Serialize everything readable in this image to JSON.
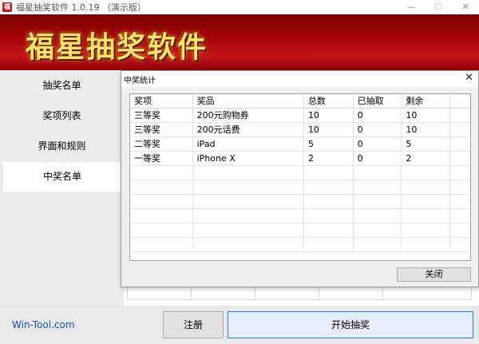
{
  "window": {
    "icon_glyph": "福",
    "title": "福星抽奖软件 1.0.19 （演示版）",
    "minimize_glyph": "—",
    "maximize_glyph": "☐",
    "close_glyph": "✕"
  },
  "banner": {
    "title": "福星抽奖软件"
  },
  "sidebar": {
    "items": [
      {
        "label": "抽奖名单"
      },
      {
        "label": "奖项列表"
      },
      {
        "label": "界面和规则"
      },
      {
        "label": "中奖名单"
      }
    ],
    "active_index": 3
  },
  "footer": {
    "brand": "Win-Tool.com",
    "register_label": "注册",
    "start_label": "开始抽奖"
  },
  "dialog": {
    "title": "中奖统计",
    "close_glyph": "✕",
    "columns": [
      "奖项",
      "奖品",
      "总数",
      "已抽取",
      "剩余"
    ],
    "rows": [
      [
        "三等奖",
        "200元购物券",
        "10",
        "0",
        "10"
      ],
      [
        "三等奖",
        "200元话费",
        "10",
        "0",
        "10"
      ],
      [
        "二等奖",
        "iPad",
        "5",
        "0",
        "5"
      ],
      [
        "一等奖",
        "iPhone X",
        "2",
        "0",
        "2"
      ]
    ],
    "close_button_label": "关闭"
  }
}
